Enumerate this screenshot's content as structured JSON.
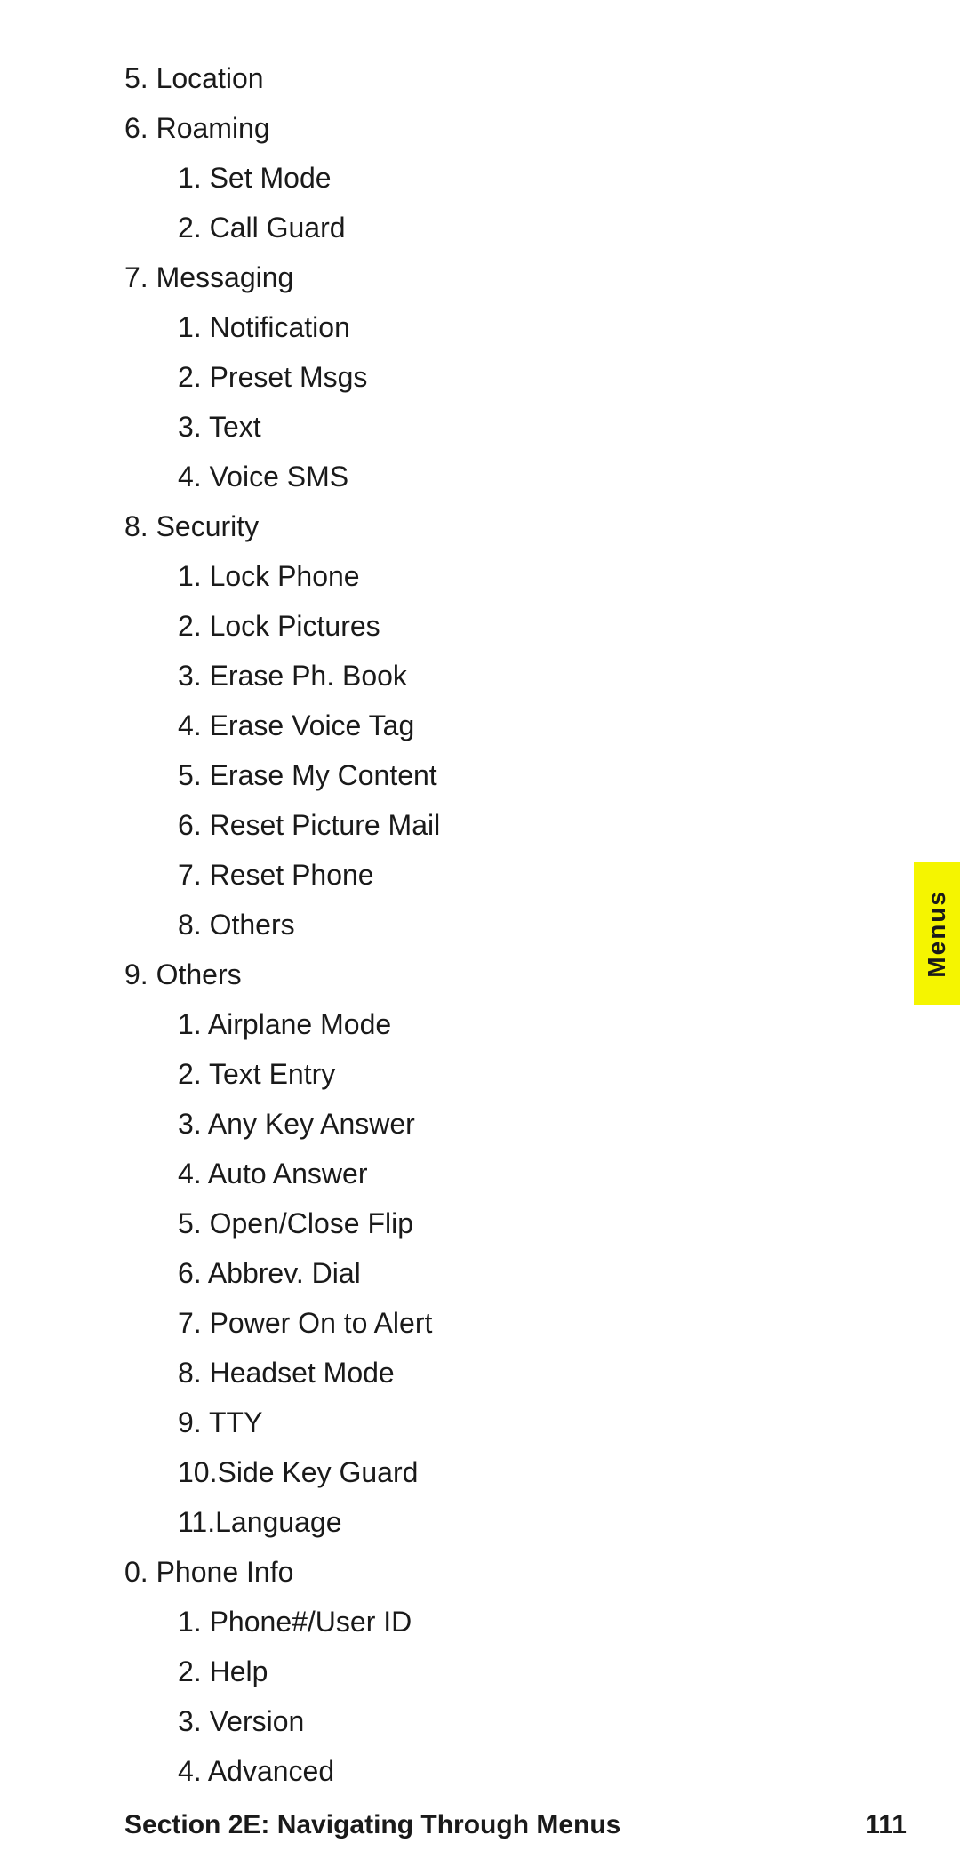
{
  "page": {
    "items": [
      {
        "level": 1,
        "text": "5.  Location"
      },
      {
        "level": 1,
        "text": "6.  Roaming"
      },
      {
        "level": 2,
        "text": "1.  Set Mode"
      },
      {
        "level": 2,
        "text": "2.  Call Guard"
      },
      {
        "level": 1,
        "text": "7.  Messaging"
      },
      {
        "level": 2,
        "text": "1.  Notification"
      },
      {
        "level": 2,
        "text": "2.  Preset Msgs"
      },
      {
        "level": 2,
        "text": "3.  Text"
      },
      {
        "level": 2,
        "text": "4.  Voice SMS"
      },
      {
        "level": 1,
        "text": "8.  Security"
      },
      {
        "level": 2,
        "text": "1.  Lock Phone"
      },
      {
        "level": 2,
        "text": "2.  Lock Pictures"
      },
      {
        "level": 2,
        "text": "3.  Erase Ph. Book"
      },
      {
        "level": 2,
        "text": "4.  Erase Voice Tag"
      },
      {
        "level": 2,
        "text": "5.  Erase My Content"
      },
      {
        "level": 2,
        "text": "6.  Reset Picture Mail"
      },
      {
        "level": 2,
        "text": "7.  Reset Phone"
      },
      {
        "level": 2,
        "text": "8.  Others"
      },
      {
        "level": 1,
        "text": "9.  Others"
      },
      {
        "level": 2,
        "text": "1.  Airplane Mode"
      },
      {
        "level": 2,
        "text": "2.  Text Entry"
      },
      {
        "level": 2,
        "text": "3.  Any Key Answer"
      },
      {
        "level": 2,
        "text": "4.  Auto Answer"
      },
      {
        "level": 2,
        "text": "5.  Open/Close Flip"
      },
      {
        "level": 2,
        "text": "6.  Abbrev. Dial"
      },
      {
        "level": 2,
        "text": "7.  Power On to Alert"
      },
      {
        "level": 2,
        "text": "8.  Headset Mode"
      },
      {
        "level": 2,
        "text": "9.  TTY"
      },
      {
        "level": 2,
        "text": "10.Side Key Guard"
      },
      {
        "level": 2,
        "text": "11.Language"
      },
      {
        "level": 1,
        "text": "0.  Phone Info"
      },
      {
        "level": 2,
        "text": "1.  Phone#/User ID"
      },
      {
        "level": 2,
        "text": "2.  Help"
      },
      {
        "level": 2,
        "text": "3.  Version"
      },
      {
        "level": 2,
        "text": "4.  Advanced"
      }
    ],
    "footer": {
      "title": "Section 2E: Navigating Through Menus",
      "page": "111"
    },
    "side_tab": "Menus"
  }
}
